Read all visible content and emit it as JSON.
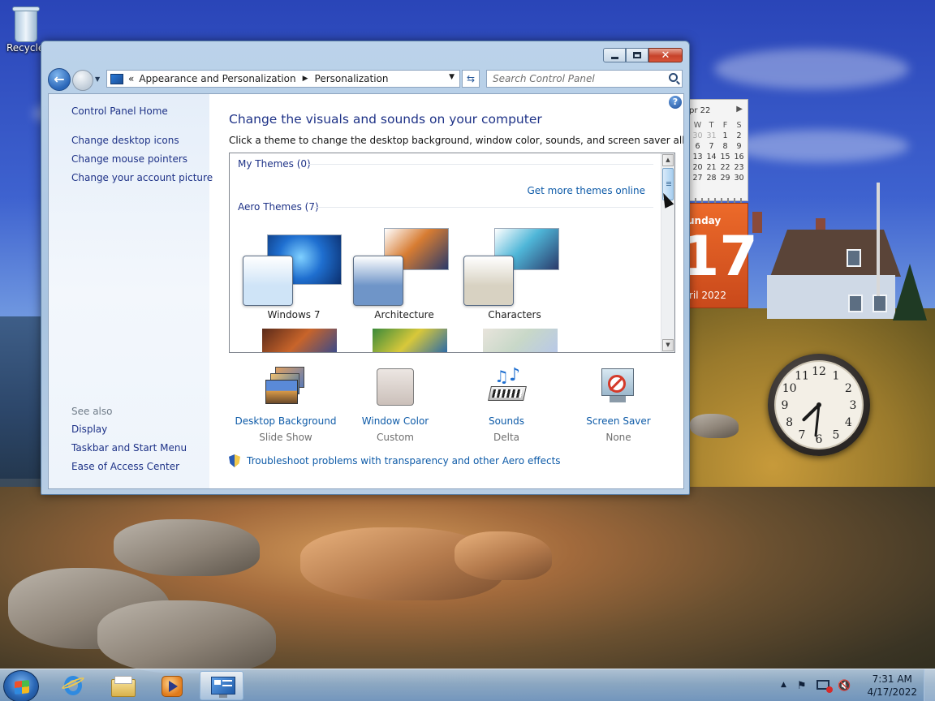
{
  "desktop": {
    "recycle_bin_label": "Recycle"
  },
  "calendar_gadget": {
    "month_header": "pr 22",
    "day_headers": [
      "W",
      "T",
      "F",
      "S"
    ],
    "rows": [
      [
        "30",
        "31",
        "1",
        "2"
      ],
      [
        "6",
        "7",
        "8",
        "9"
      ],
      [
        "13",
        "14",
        "15",
        "16"
      ],
      [
        "20",
        "21",
        "22",
        "23"
      ],
      [
        "27",
        "28",
        "29",
        "30"
      ]
    ],
    "weekday": "unday",
    "day_number": "17",
    "month_year": "ril 2022"
  },
  "clock_gadget": {
    "numbers": [
      "12",
      "1",
      "2",
      "3",
      "4",
      "5",
      "6",
      "7",
      "8",
      "9",
      "10",
      "11"
    ],
    "time": {
      "hour": 7,
      "minute": 31
    }
  },
  "window": {
    "title_buttons": {
      "minimize": "minimize",
      "maximize": "maximize",
      "close": "✕"
    },
    "nav": {
      "recent_arrow": "▼",
      "breadcrumb_prefix": "«",
      "breadcrumbs": [
        "Appearance and Personalization",
        "Personalization"
      ],
      "breadcrumb_separator": "▶",
      "address_dropdown": "▼",
      "refresh_icon": "⇆",
      "search_placeholder": "Search Control Panel"
    },
    "left_pane": {
      "home_link": "Control Panel Home",
      "links": [
        "Change desktop icons",
        "Change mouse pointers",
        "Change your account picture"
      ],
      "see_also_label": "See also",
      "see_also_links": [
        "Display",
        "Taskbar and Start Menu",
        "Ease of Access Center"
      ]
    },
    "main": {
      "help_icon": "?",
      "title": "Change the visuals and sounds on your computer",
      "subtitle": "Click a theme to change the desktop background, window color, sounds, and screen saver all at once.",
      "my_themes_header": "My Themes (0)",
      "get_more_link": "Get more themes online",
      "aero_themes_header": "Aero Themes (7)",
      "themes": [
        {
          "name": "Windows 7",
          "accent": "#1f6fd0",
          "swatch": "#cfe4f7"
        },
        {
          "name": "Architecture",
          "accent": "#d77c32",
          "swatch": "#6f95c8"
        },
        {
          "name": "Characters",
          "accent": "#4fb6d8",
          "swatch": "#d8d2c2"
        }
      ],
      "scroll": {
        "up": "▲",
        "down": "▼"
      },
      "bottom_items": [
        {
          "label": "Desktop Background",
          "value": "Slide Show"
        },
        {
          "label": "Window Color",
          "value": "Custom"
        },
        {
          "label": "Sounds",
          "value": "Delta"
        },
        {
          "label": "Screen Saver",
          "value": "None"
        }
      ],
      "troubleshoot_link": "Troubleshoot problems with transparency and other Aero effects"
    }
  },
  "taskbar": {
    "tray_chevron": "▲",
    "time": "7:31 AM",
    "date": "4/17/2022"
  }
}
